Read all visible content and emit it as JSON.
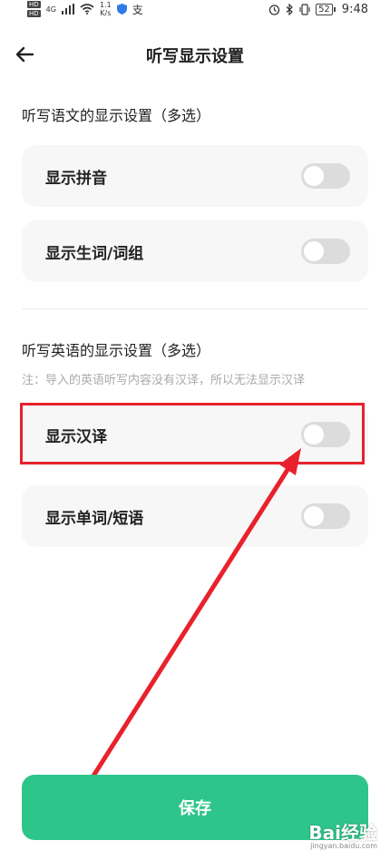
{
  "status_bar": {
    "hd_label": "HD",
    "net_4g": "4G",
    "speed_value": "1.1",
    "speed_unit": "K/s",
    "alipay_glyph": "支",
    "battery": "52",
    "time": "9:48"
  },
  "header": {
    "title": "听写显示设置"
  },
  "chinese_section": {
    "title": "听写语文的显示设置（多选）",
    "options": [
      {
        "label": "显示拼音"
      },
      {
        "label": "显示生词/词组"
      }
    ]
  },
  "english_section": {
    "title": "听写英语的显示设置（多选）",
    "note": "注：导入的英语听写内容没有汉译，所以无法显示汉译",
    "options": [
      {
        "label": "显示汉译"
      },
      {
        "label": "显示单词/短语"
      }
    ]
  },
  "save_label": "保存",
  "watermark": {
    "text": "Bai经验",
    "sub": "jingyan.baidu.com"
  },
  "colors": {
    "accent": "#2ec58a",
    "highlight": "#e8212c",
    "toggle_off": "#dcdcdc"
  }
}
